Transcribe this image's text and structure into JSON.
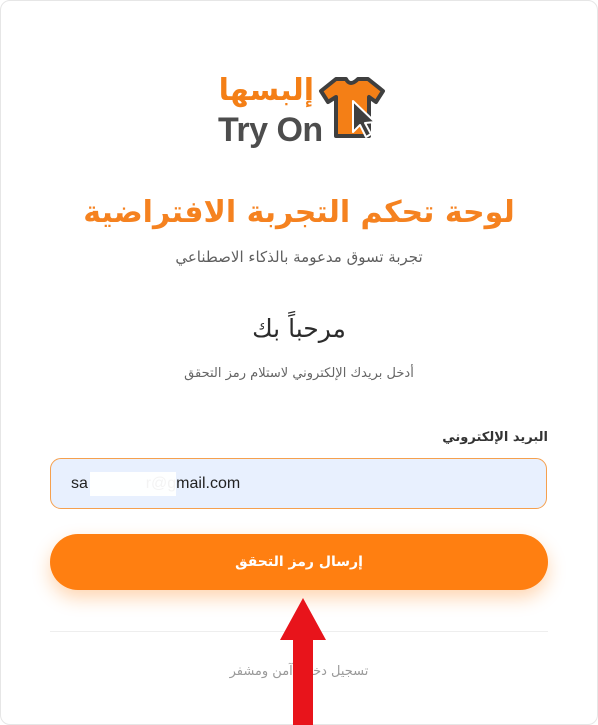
{
  "logo": {
    "arabic_text": "إلبسها",
    "english_text": "Try On",
    "icon": "shirt-cursor-icon",
    "colors": {
      "orange": "#f47f16",
      "gray": "#4d4d4d"
    }
  },
  "header": {
    "title": "لوحة تحكم التجربة الافتراضية",
    "subtitle": "تجربة تسوق مدعومة بالذكاء الاصطناعي"
  },
  "welcome": {
    "heading": "مرحباً بك",
    "instruction": "أدخل بريدك الإلكتروني لاستلام رمز التحقق"
  },
  "form": {
    "email_label": "البريد الإلكتروني",
    "email_value": "sa             r@gmail.com",
    "send_button": "إرسال رمز التحقق"
  },
  "footer": {
    "secure_text": "تسجيل دخول آمن ومشفر"
  },
  "annotation": {
    "arrow_color": "#e8141b",
    "icon": "up-arrow-annotation"
  },
  "colors": {
    "accent": "#ff7f11",
    "title": "#f58220",
    "input_background": "#e8f0fe"
  }
}
